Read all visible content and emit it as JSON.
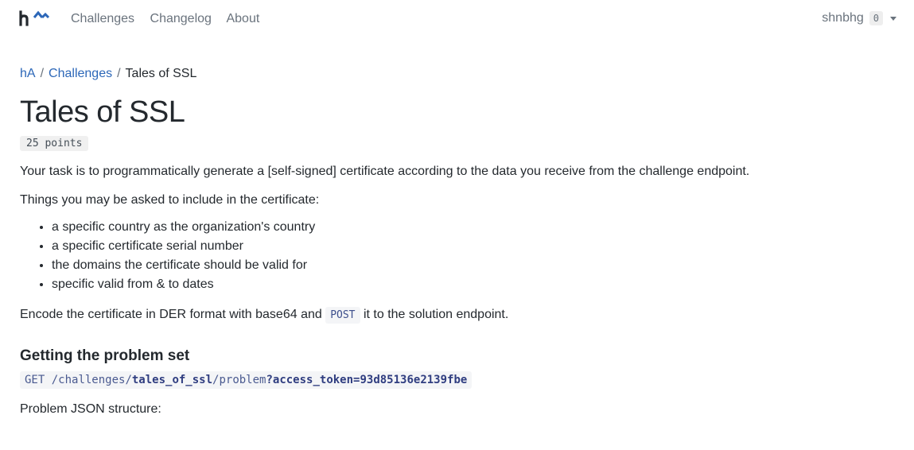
{
  "header": {
    "logo_alt": "h^",
    "nav": [
      "Challenges",
      "Changelog",
      "About"
    ],
    "username": "shnbhg",
    "badge": "0"
  },
  "breadcrumb": [
    "hA",
    "Challenges",
    "Tales of SSL"
  ],
  "title": "Tales of SSL",
  "points": "25 points",
  "intro": "Your task is to programmatically generate a [self-signed] certificate according to the data you receive from the challenge endpoint.",
  "list_intro": "Things you may be asked to include in the certificate:",
  "list_items": [
    "a specific country as the organization's country",
    "a specific certificate serial number",
    "the domains the certificate should be valid for",
    "specific valid from & to dates"
  ],
  "encode": {
    "before": "Encode the certificate in DER format with base64 and ",
    "code": "POST",
    "after": " it to the solution endpoint."
  },
  "section_title": "Getting the problem set",
  "request": {
    "method": "GET",
    "path_start": " /challenges/",
    "challenge": "tales_of_ssl",
    "path_end": "/problem",
    "query": "?access_token=93d85136e2139fbe"
  },
  "json_structure_label": "Problem JSON structure:"
}
